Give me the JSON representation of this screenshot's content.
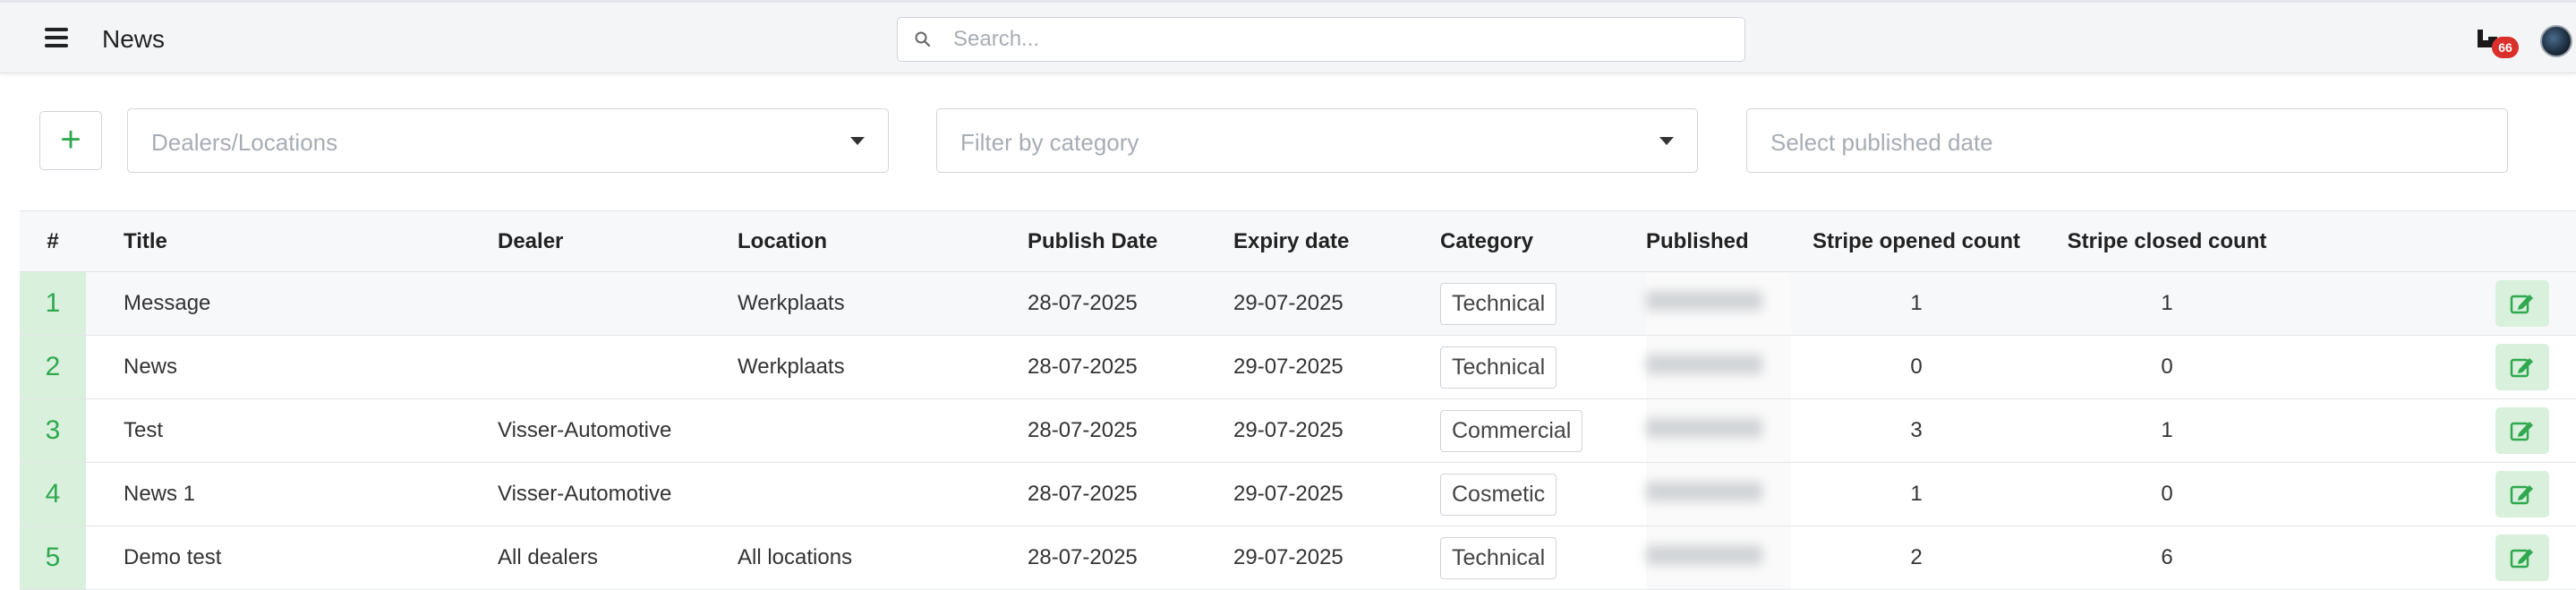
{
  "header": {
    "title": "News",
    "search_placeholder": "Search...",
    "notification_count": "66"
  },
  "filters": {
    "dealers_placeholder": "Dealers/Locations",
    "category_placeholder": "Filter by category",
    "date_placeholder": "Select published date",
    "add_label": "+"
  },
  "table": {
    "headers": {
      "num": "#",
      "title": "Title",
      "dealer": "Dealer",
      "location": "Location",
      "publish_date": "Publish Date",
      "expiry_date": "Expiry date",
      "category": "Category",
      "published": "Published",
      "opened": "Stripe opened count",
      "closed": "Stripe closed count"
    },
    "rows": [
      {
        "num": "1",
        "title": "Message",
        "dealer": "",
        "location": "Werkplaats",
        "publish_date": "28-07-2025",
        "expiry_date": "29-07-2025",
        "category": "Technical",
        "opened": "1",
        "closed": "1"
      },
      {
        "num": "2",
        "title": "News",
        "dealer": "",
        "location": "Werkplaats",
        "publish_date": "28-07-2025",
        "expiry_date": "29-07-2025",
        "category": "Technical",
        "opened": "0",
        "closed": "0"
      },
      {
        "num": "3",
        "title": "Test",
        "dealer": "Visser-Automotive",
        "location": "",
        "publish_date": "28-07-2025",
        "expiry_date": "29-07-2025",
        "category": "Commercial",
        "opened": "3",
        "closed": "1"
      },
      {
        "num": "4",
        "title": "News 1",
        "dealer": "Visser-Automotive",
        "location": "",
        "publish_date": "28-07-2025",
        "expiry_date": "29-07-2025",
        "category": "Cosmetic",
        "opened": "1",
        "closed": "0"
      },
      {
        "num": "5",
        "title": "Demo test",
        "dealer": "All dealers",
        "location": "All locations",
        "publish_date": "28-07-2025",
        "expiry_date": "29-07-2025",
        "category": "Technical",
        "opened": "2",
        "closed": "6"
      }
    ]
  },
  "colors": {
    "accent_green": "#2fa84f",
    "green_bg": "#d8f0dc",
    "badge_red": "#d9302c"
  },
  "icons": {
    "menu": "hamburger-icon",
    "search": "search-icon",
    "notifications": "notification-icon",
    "edit": "edit-icon",
    "caret": "chevron-down-icon"
  }
}
